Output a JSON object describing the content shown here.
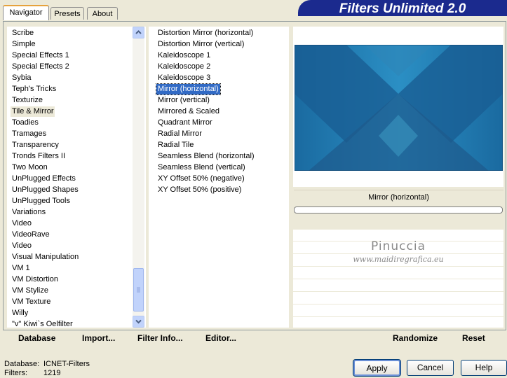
{
  "tabs": [
    {
      "label": "Navigator",
      "active": true
    },
    {
      "label": "Presets",
      "active": false
    },
    {
      "label": "About",
      "active": false
    }
  ],
  "app_title": "Filters Unlimited 2.0",
  "categories": [
    "Scribe",
    "Simple",
    "Special Effects 1",
    "Special Effects 2",
    "Sybia",
    "Teph's Tricks",
    "Texturize",
    "Tile & Mirror",
    "Toadies",
    "Tramages",
    "Transparency",
    "Tronds Filters II",
    "Two Moon",
    "UnPlugged Effects",
    "UnPlugged Shapes",
    "UnPlugged Tools",
    "Variations",
    "Video",
    "VideoRave",
    "Video",
    "Visual Manipulation",
    "VM 1",
    "VM Distortion",
    "VM Stylize",
    "VM Texture",
    "Willy",
    "\"v\" Kiwi`s Oelfilter"
  ],
  "selected_category": "Tile & Mirror",
  "filters": [
    "Distortion Mirror (horizontal)",
    "Distortion Mirror (vertical)",
    "Kaleidoscope 1",
    "Kaleidoscope 2",
    "Kaleidoscope 3",
    "Mirror (horizontal)",
    "Mirror (vertical)",
    "Mirrored & Scaled",
    "Quadrant Mirror",
    "Radial Mirror",
    "Radial Tile",
    "Seamless Blend (horizontal)",
    "Seamless Blend (vertical)",
    "XY Offset 50% (negative)",
    "XY Offset 50% (positive)"
  ],
  "selected_filter": "Mirror (horizontal)",
  "preview_filter_name": "Mirror (horizontal)",
  "progress": 0,
  "watermark": {
    "name": "Pinuccia",
    "url": "www.maidiregrafica.eu"
  },
  "actions": {
    "database": "Database",
    "import": "Import...",
    "filter_info": "Filter Info...",
    "editor": "Editor...",
    "randomize": "Randomize",
    "reset": "Reset"
  },
  "status": {
    "database_label": "Database:",
    "database_value": "ICNET-Filters",
    "filters_label": "Filters:",
    "filters_value": "1219"
  },
  "buttons": {
    "apply": "Apply",
    "cancel": "Cancel",
    "help": "Help"
  },
  "colors": {
    "banner": "#1b2a8e",
    "selection": "#316ac5",
    "background": "#ece9d8"
  }
}
